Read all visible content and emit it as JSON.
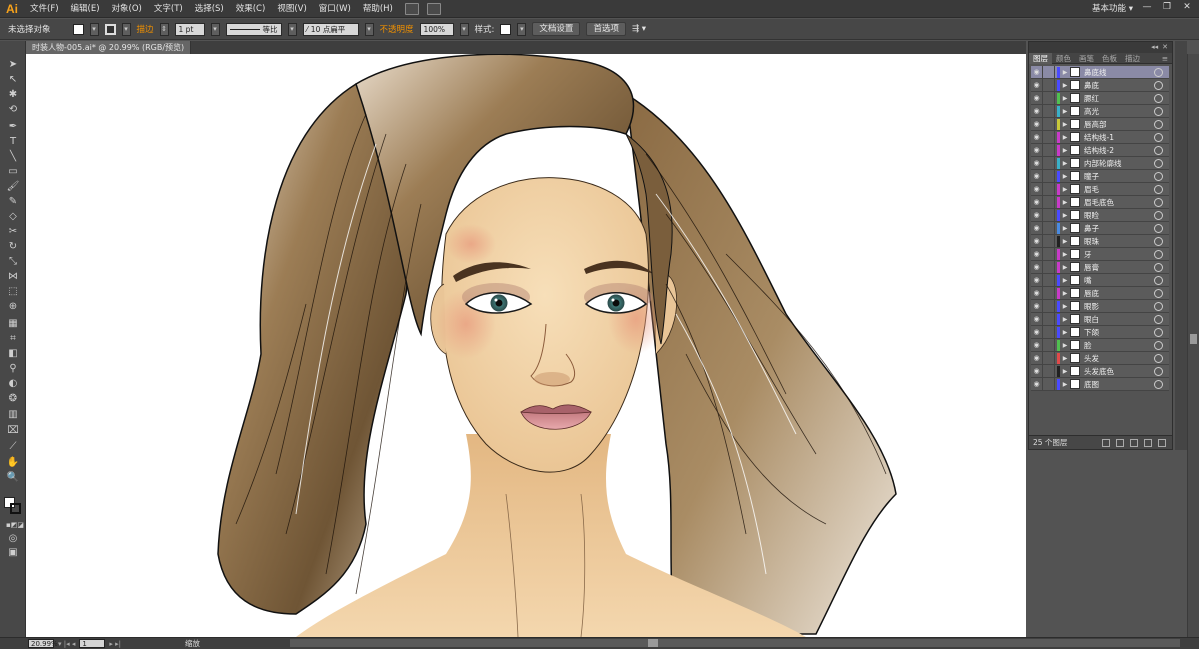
{
  "app": {
    "logo": "Ai",
    "workspace": "基本功能 ▾"
  },
  "menu": [
    "文件(F)",
    "编辑(E)",
    "对象(O)",
    "文字(T)",
    "选择(S)",
    "效果(C)",
    "视图(V)",
    "窗口(W)",
    "帮助(H)"
  ],
  "control": {
    "selection": "未选择对象",
    "stroke_label": "描边",
    "stroke_weight": "1 pt",
    "profile": "等比",
    "brush": "10 点扁平",
    "opacity_label": "不透明度",
    "opacity": "100%",
    "style_label": "样式:",
    "doc_setup": "文档设置",
    "prefs": "首选项"
  },
  "document": {
    "tab": "时装人物-005.ai* @ 20.99% (RGB/预览)"
  },
  "status": {
    "zoom": "20.99%",
    "page": "1",
    "tool": "缩放"
  },
  "panel": {
    "tabs": [
      "图层",
      "颜色",
      "画笔",
      "色板",
      "描边"
    ],
    "count": "25 个图层",
    "layers": [
      {
        "name": "鼻底线",
        "color": "#4a4aff",
        "selected": true
      },
      {
        "name": "鼻底",
        "color": "#4a4aff"
      },
      {
        "name": "腮红",
        "color": "#50c050"
      },
      {
        "name": "高光",
        "color": "#3ab0c8"
      },
      {
        "name": "唇高部",
        "color": "#c8c83a"
      },
      {
        "name": "结构线-1",
        "color": "#c83ac8"
      },
      {
        "name": "结构线-2",
        "color": "#c83ac8"
      },
      {
        "name": "内部轮廓线",
        "color": "#3ab0c8"
      },
      {
        "name": "瞳子",
        "color": "#4a4aff"
      },
      {
        "name": "眉毛",
        "color": "#c83ac8"
      },
      {
        "name": "眉毛底色",
        "color": "#c83ac8"
      },
      {
        "name": "眼睑",
        "color": "#4a4aff"
      },
      {
        "name": "鼻子",
        "color": "#4a8ae0"
      },
      {
        "name": "眼珠",
        "color": "#222222"
      },
      {
        "name": "牙",
        "color": "#c83ac8"
      },
      {
        "name": "唇膏",
        "color": "#c83ac8"
      },
      {
        "name": "嘴",
        "color": "#4a4aff"
      },
      {
        "name": "唇底",
        "color": "#c83ac8"
      },
      {
        "name": "眼影",
        "color": "#4a4aff"
      },
      {
        "name": "眼白",
        "color": "#4a4aff"
      },
      {
        "name": "下颌",
        "color": "#4a4aff"
      },
      {
        "name": "脸",
        "color": "#50c050"
      },
      {
        "name": "头发",
        "color": "#e04a4a"
      },
      {
        "name": "头发底色",
        "color": "#222222"
      },
      {
        "name": "底图",
        "color": "#4a4aff"
      }
    ]
  }
}
